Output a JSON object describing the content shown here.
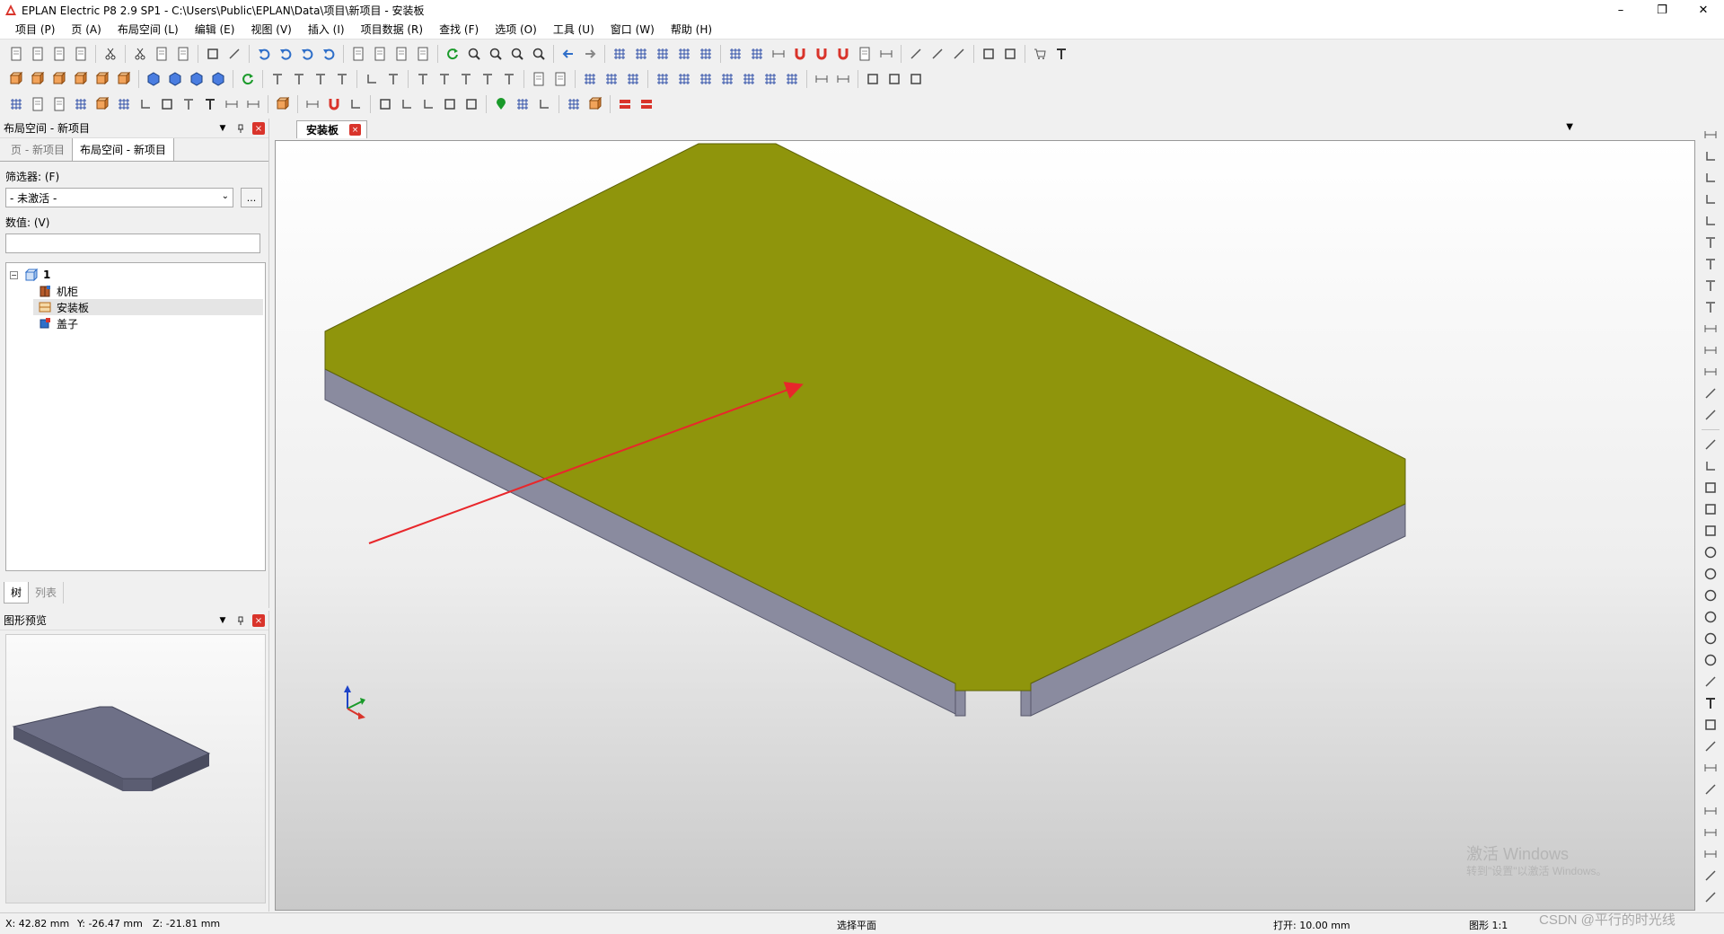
{
  "window": {
    "title": "EPLAN Electric P8 2.9 SP1 - C:\\Users\\Public\\EPLAN\\Data\\项目\\新项目 - 安装板",
    "minimize": "–",
    "restore": "❐",
    "close": "✕"
  },
  "menu": [
    "项目 (P)",
    "页 (A)",
    "布局空间 (L)",
    "编辑 (E)",
    "视图 (V)",
    "插入 (I)",
    "项目数据 (R)",
    "查找 (F)",
    "选项 (O)",
    "工具 (U)",
    "窗口 (W)",
    "帮助 (H)"
  ],
  "layout_panel": {
    "title": "布局空间 - 新项目",
    "tabs": [
      "页 - 新项目",
      "布局空间 - 新项目"
    ],
    "filter_label": "筛选器: (F)",
    "filter_value": "- 未激活 -",
    "filter_more": "...",
    "value_label": "数值: (V)",
    "tree": {
      "root": "1",
      "toggle": "−",
      "children": [
        "机柜",
        "安装板",
        "盖子"
      ]
    },
    "bottom_tabs": [
      "树",
      "列表"
    ]
  },
  "preview_panel": {
    "title": "图形预览"
  },
  "document": {
    "tab_label": "安装板",
    "tab_close": "×",
    "dropdown": "▼"
  },
  "status": {
    "x": "X: 42.82 mm",
    "y": "Y: -26.47 mm",
    "z": "Z: -21.81 mm",
    "mode": "选择平面",
    "grid": "打开: 10.00 mm",
    "scale": "图形 1:1"
  },
  "watermarks": {
    "activate_title": "激活 Windows",
    "activate_sub": "转到\"设置\"以激活 Windows。",
    "csdn": "CSDN @平行的时光线"
  },
  "colors": {
    "plate_top": "#8f950c",
    "plate_side": "#8a8b9f",
    "accent_red": "#d9342b"
  }
}
